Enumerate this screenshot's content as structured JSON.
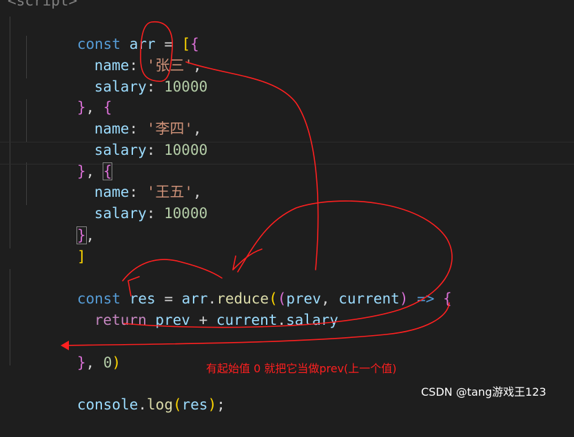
{
  "editor": {
    "tag_open": "<script>",
    "lines": {
      "l1": {
        "kw": "const",
        "name": "arr",
        "eq": " = ",
        "b1": "[",
        "b2": "{"
      },
      "l2": {
        "key": "name",
        "colon": ": ",
        "val": "'张三'",
        "comma": ","
      },
      "l3": {
        "key": "salary",
        "colon": ": ",
        "val": "10000"
      },
      "l4": {
        "b": "}",
        "sep": ", ",
        "b2": "{"
      },
      "l5": {
        "key": "name",
        "colon": ": ",
        "val": "'李四'",
        "comma": ","
      },
      "l6": {
        "key": "salary",
        "colon": ": ",
        "val": "10000"
      },
      "l7": {
        "b": "}",
        "sep": ", ",
        "b2": "{"
      },
      "l8": {
        "key": "name",
        "colon": ": ",
        "val": "'王五'",
        "comma": ","
      },
      "l9": {
        "key": "salary",
        "colon": ": ",
        "val": "10000"
      },
      "l10": {
        "b": "}",
        "comma": ","
      },
      "l11": {
        "b": "]"
      },
      "l13": {
        "kw": "const",
        "name": "res",
        "eq": " = ",
        "obj": "arr",
        "dot": ".",
        "fn": "reduce",
        "p1": "(",
        "p2": "(",
        "a1": "prev",
        "sep": ", ",
        "a2": "current",
        "p3": ")",
        "arrow": " => ",
        "b": "{"
      },
      "l14": {
        "kw": "return",
        "a1": "prev",
        "op": " + ",
        "a2": "current",
        "dot": ".",
        "prop": "salary"
      },
      "l16": {
        "b": "}",
        "sep": ", ",
        "num": "0",
        "p": ")"
      },
      "l18": {
        "obj": "console",
        "dot": ".",
        "fn": "log",
        "p1": "(",
        "arg": "res",
        "p2": ")",
        "semi": ";"
      }
    }
  },
  "annotation": "有起始值 0 就把它当做prev(上一个值)",
  "watermark": "CSDN @tang游戏王123",
  "colors": {
    "ink": "#ff2020",
    "background": "#1e1e1e"
  }
}
